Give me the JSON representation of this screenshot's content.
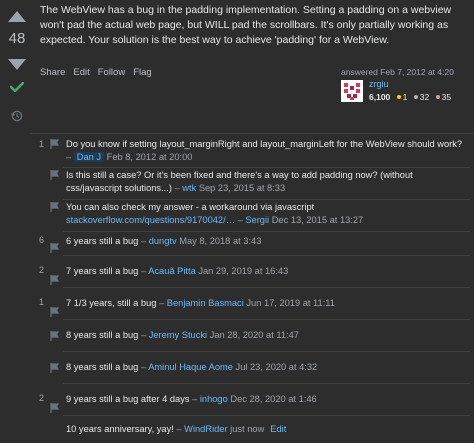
{
  "vote": {
    "score": "48"
  },
  "post": {
    "text": "The WebView has a bug in the padding implementation. Setting a padding on a webview won't pad the actual web page, but WILL pad the scrollbars. It's only partially working as expected. Your solution is the best way to achieve 'padding' for a WebView.",
    "menu": {
      "share": "Share",
      "edit": "Edit",
      "follow": "Follow",
      "flag": "Flag"
    }
  },
  "signature": {
    "action": "answered Feb 7, 2012 at 4:20",
    "user": "zrgiu",
    "reputation": "6,100",
    "gold": "1",
    "silver": "32",
    "bronze": "35"
  },
  "comments": [
    {
      "score": "1",
      "text": "Do you know if setting layout_marginRight and layout_marginLeft for the WebView should work?",
      "sep": " – ",
      "user": "Dan J",
      "date": "Feb 8, 2012 at 20:00"
    },
    {
      "score": "",
      "text": "Is this still a case? Or it's been fixed and there's a way to add padding now? (without css/javascript solutions...)",
      "sep": " – ",
      "user": "wtk",
      "date": "Sep 23, 2015 at 8:33"
    },
    {
      "score": "",
      "text": "You can also check my answer - a workaround via javascript ",
      "link": "stackoverflow.com/questions/9170042/…",
      "sep": " – ",
      "user": "Sergii",
      "date": "Dec 13, 2015 at 13:27"
    },
    {
      "score": "6",
      "text": "6 years still a bug",
      "sep": " – ",
      "user": "dungtv",
      "date": "May 8, 2018 at 3:43"
    },
    {
      "score": "2",
      "text": "7 years still a bug",
      "sep": " – ",
      "user": "Acauã Pitta",
      "date": "Jan 29, 2019 at 16:43"
    },
    {
      "score": "1",
      "text": "7 1/3 years, still a bug",
      "sep": " – ",
      "user": "Benjamin Basmaci",
      "date": "Jun 17, 2019 at 11:11"
    },
    {
      "score": "",
      "text": "8 years still a bug",
      "sep": " – ",
      "user": "Jeremy Stucki",
      "date": "Jan 28, 2020 at 11:47"
    },
    {
      "score": "",
      "text": "8 years still a bug",
      "sep": " – ",
      "user": "Aminul Haque Aome",
      "date": "Jul 23, 2020 at 4:32"
    },
    {
      "score": "2",
      "text": "9 years still a bug after 4 days",
      "sep": " – ",
      "user": "inhogo",
      "date": "Dec 28, 2020 at 1:46"
    },
    {
      "score": "",
      "text": "10 years anniversary, yay!",
      "sep": " – ",
      "user": "WindRider",
      "date": "just now",
      "edit": "Edit"
    }
  ],
  "colors": {
    "link": "#6cbbf7",
    "accepted": "#48a868",
    "background": "#2d2d2d"
  }
}
